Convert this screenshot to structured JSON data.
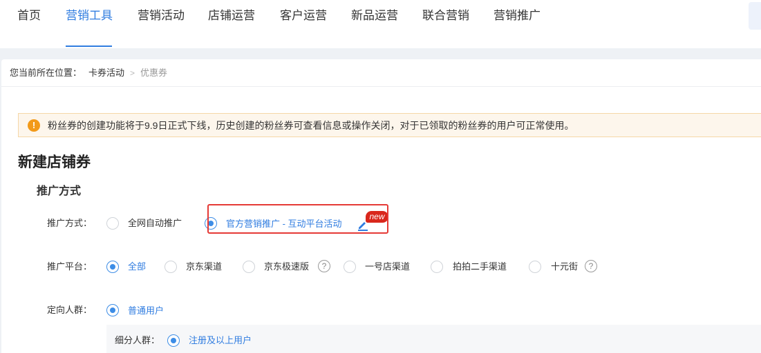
{
  "nav": {
    "items": [
      "首页",
      "营销工具",
      "营销活动",
      "店铺运营",
      "客户运营",
      "新品运营",
      "联合营销",
      "营销推广"
    ],
    "active_index": 1
  },
  "breadcrumb": {
    "prefix": "您当前所在位置：",
    "items": [
      "卡券活动",
      "优惠券"
    ],
    "separator": ">"
  },
  "notice": {
    "icon": "!",
    "text": "粉丝券的创建功能将于9.9日正式下线，历史创建的粉丝券可查看信息或操作关闭，对于已领取的粉丝券的用户可正常使用。"
  },
  "page_title": "新建店铺券",
  "section_title": "推广方式",
  "promotion_method": {
    "label": "推广方式：",
    "options": [
      {
        "label": "全网自动推广",
        "selected": false
      },
      {
        "label": "官方营销推广 - 互动平台活动",
        "selected": true
      }
    ],
    "badge": "new"
  },
  "platform": {
    "label": "推广平台：",
    "options": [
      {
        "label": "全部",
        "selected": true
      },
      {
        "label": "京东渠道",
        "selected": false
      },
      {
        "label": "京东极速版",
        "selected": false
      },
      {
        "label": "一号店渠道",
        "selected": false
      },
      {
        "label": "拍拍二手渠道",
        "selected": false
      },
      {
        "label": "十元街",
        "selected": false
      }
    ],
    "help_icon": "?"
  },
  "audience": {
    "label": "定向人群：",
    "option": "普通用户",
    "sub_label": "细分人群：",
    "sub_option": "注册及以上用户"
  },
  "colors": {
    "accent": "#2f7ce0",
    "warning": "#f29a19",
    "highlight": "#e53935",
    "badge": "#d9271c"
  }
}
